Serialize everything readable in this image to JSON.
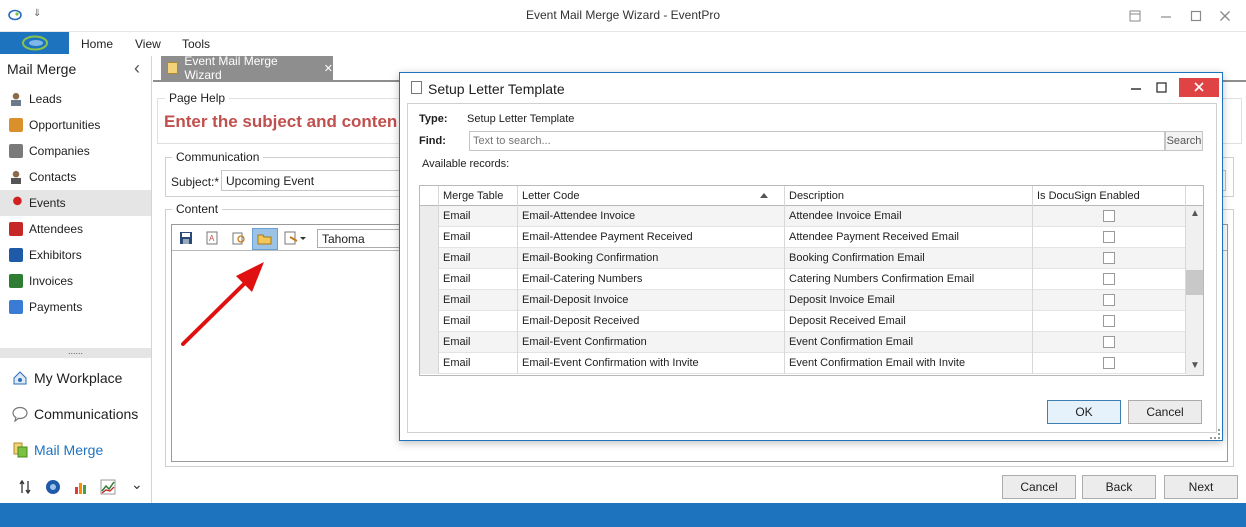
{
  "window": {
    "title": "Event Mail Merge Wizard - EventPro",
    "title_arrow": "⇓"
  },
  "ribbon": {
    "menu": [
      "Home",
      "View",
      "Tools"
    ]
  },
  "sidebar": {
    "header": "Mail Merge",
    "collapse_glyph": "‹",
    "items": [
      {
        "label": "Leads",
        "icon": "person-icon",
        "color": "#7a5a3a"
      },
      {
        "label": "Opportunities",
        "icon": "opportunities-icon",
        "color": "#c47b1a"
      },
      {
        "label": "Companies",
        "icon": "companies-icon",
        "color": "#6a6a6a"
      },
      {
        "label": "Contacts",
        "icon": "contact-icon",
        "color": "#7a5a3a"
      },
      {
        "label": "Events",
        "icon": "pushpin-icon",
        "color": "#d02020"
      },
      {
        "label": "Attendees",
        "icon": "attendees-icon",
        "color": "#c62828"
      },
      {
        "label": "Exhibitors",
        "icon": "exhibitors-icon",
        "color": "#1e5aa8"
      },
      {
        "label": "Invoices",
        "icon": "invoice-icon",
        "color": "#2e7d32"
      },
      {
        "label": "Payments",
        "icon": "payments-icon",
        "color": "#3a7bd5"
      }
    ],
    "splitter": "......",
    "big": [
      {
        "label": "My Workplace",
        "icon": "workplace-icon"
      },
      {
        "label": "Communications",
        "icon": "speech-bubble-icon"
      },
      {
        "label": "Mail Merge",
        "icon": "mail-merge-icon"
      }
    ],
    "more_glyph": "⌄"
  },
  "doc_tab": {
    "label": "Event Mail Merge Wizard",
    "close": "✕"
  },
  "wizard": {
    "page_help_legend": "Page Help",
    "heading": "Enter the subject and conten",
    "communication_legend": "Communication",
    "subject_label": "Subject:*",
    "subject_value": "Upcoming Event",
    "content_legend": "Content",
    "font_value": "Tahoma"
  },
  "footer": {
    "cancel": "Cancel",
    "back": "Back",
    "next": "Next"
  },
  "dialog": {
    "title": "Setup Letter Template",
    "type_label": "Type:",
    "type_value": "Setup Letter Template",
    "find_label": "Find:",
    "search_placeholder": "Text to search...",
    "search_button": "Search",
    "available": "Available records:",
    "columns": [
      "Merge Table",
      "Letter Code",
      "Description",
      "Is DocuSign Enabled"
    ],
    "rows": [
      {
        "table": "Email",
        "code": "Email-Attendee Invoice",
        "desc": "Attendee Invoice Email",
        "docusign": false
      },
      {
        "table": "Email",
        "code": "Email-Attendee Payment Received",
        "desc": "Attendee Payment Received Email",
        "docusign": false
      },
      {
        "table": "Email",
        "code": "Email-Booking Confirmation",
        "desc": "Booking Confirmation Email",
        "docusign": false
      },
      {
        "table": "Email",
        "code": "Email-Catering Numbers",
        "desc": "Catering Numbers Confirmation Email",
        "docusign": false
      },
      {
        "table": "Email",
        "code": "Email-Deposit Invoice",
        "desc": "Deposit Invoice Email",
        "docusign": false
      },
      {
        "table": "Email",
        "code": "Email-Deposit Received",
        "desc": "Deposit Received Email",
        "docusign": false
      },
      {
        "table": "Email",
        "code": "Email-Event Confirmation",
        "desc": "Event Confirmation Email",
        "docusign": false
      },
      {
        "table": "Email",
        "code": "Email-Event Confirmation with Invite",
        "desc": "Event Confirmation Email with Invite",
        "docusign": false
      }
    ],
    "ok": "OK",
    "cancel": "Cancel"
  },
  "colors": {
    "accent": "#1e73be",
    "heading": "#c0504d",
    "close_red": "#e04343",
    "arrow": "#e01010"
  }
}
